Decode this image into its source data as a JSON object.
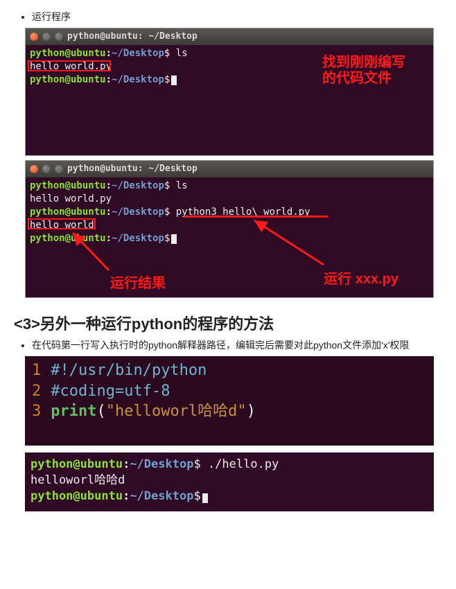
{
  "bullet1": "运行程序",
  "window": {
    "title": "python@ubuntu: ~/Desktop",
    "prompt_user": "python@ubuntu",
    "prompt_sep": ":",
    "prompt_path": "~/Desktop",
    "prompt_sign": "$"
  },
  "term1": {
    "cmd1": "ls",
    "out1": "hello world.py",
    "annot1_line1": "找到刚刚编写",
    "annot1_line2": "的代码文件"
  },
  "term2": {
    "cmd1": "ls",
    "out1": "hello world.py",
    "cmd2": "python3 hello\\ world.py",
    "out2": "hello world",
    "annot_result": "运行结果",
    "annot_run": "运行 xxx.py"
  },
  "heading3": "<3>另外一种运行python的程序的方法",
  "bullet2": "在代码第一行写入执行时的python解释器路径，编辑完后需要对此python文件添加'x'权限",
  "editor": {
    "l1": "#!/usr/bin/python",
    "l2": "#coding=utf-8",
    "l3_kw": "print",
    "l3_open": "(",
    "l3_str": "\"helloworl哈哈d\"",
    "l3_close": ")"
  },
  "exec": {
    "cmd": "./hello.py",
    "out": "helloworl哈哈d"
  }
}
